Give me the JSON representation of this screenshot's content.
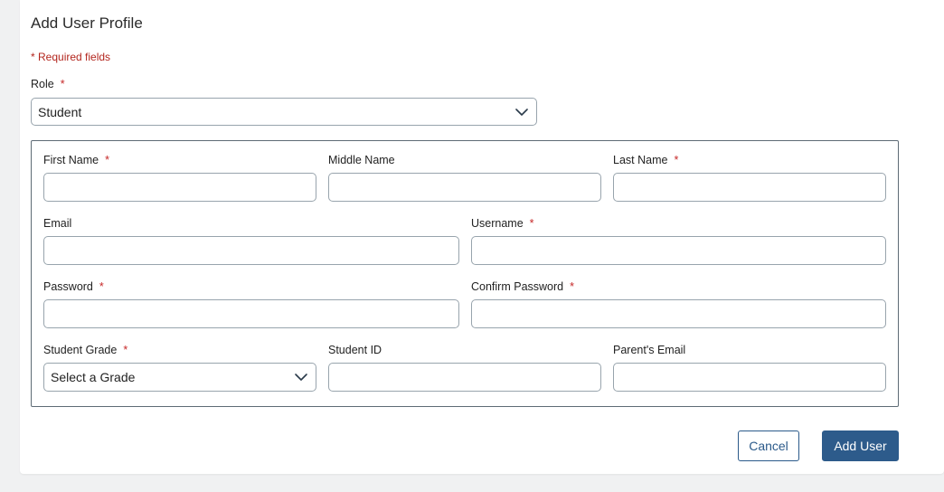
{
  "form": {
    "title": "Add User Profile",
    "required_note": "* Required fields",
    "role": {
      "label": "Role",
      "required_mark": "*",
      "value": "Student"
    },
    "fields": {
      "first_name": {
        "label": "First Name",
        "required_mark": "*",
        "value": ""
      },
      "middle_name": {
        "label": "Middle Name",
        "value": ""
      },
      "last_name": {
        "label": "Last Name",
        "required_mark": "*",
        "value": ""
      },
      "email": {
        "label": "Email",
        "value": ""
      },
      "username": {
        "label": "Username",
        "required_mark": "*",
        "value": ""
      },
      "password": {
        "label": "Password",
        "required_mark": "*",
        "value": ""
      },
      "confirm_password": {
        "label": "Confirm Password",
        "required_mark": "*",
        "value": ""
      },
      "student_grade": {
        "label": "Student Grade",
        "required_mark": "*",
        "value": "Select a Grade"
      },
      "student_id": {
        "label": "Student ID",
        "value": ""
      },
      "parents_email": {
        "label": "Parent's Email",
        "value": ""
      }
    },
    "buttons": {
      "cancel": "Cancel",
      "add_user": "Add User"
    }
  },
  "colors": {
    "primary": "#2d5b8b",
    "required": "#c62828",
    "input_border": "#98a4ad",
    "page_background": "#f0f1f2"
  },
  "icons": {
    "dropdown": "chevron-down-icon"
  }
}
